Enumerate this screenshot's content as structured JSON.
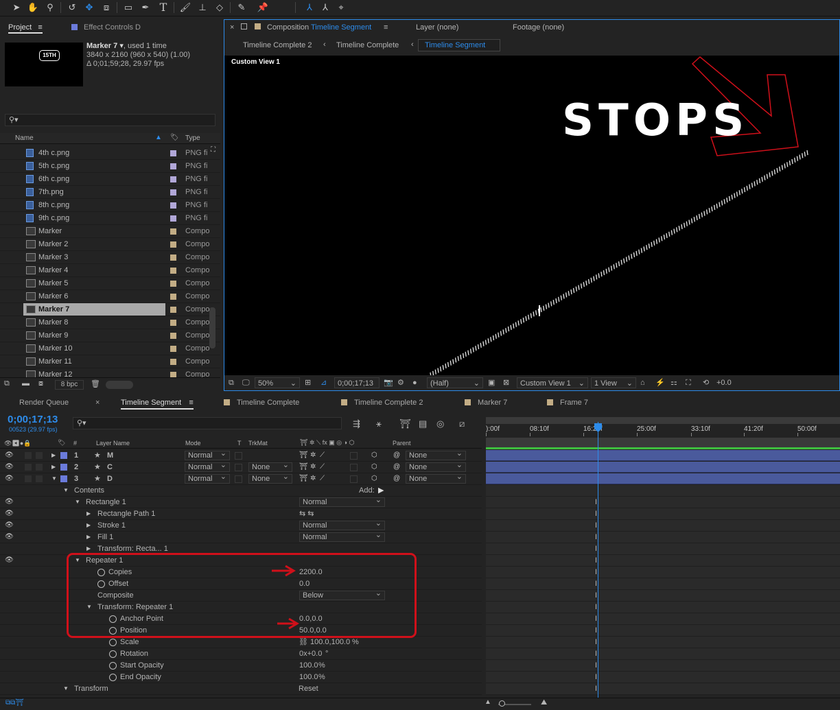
{
  "toolbar": {
    "tools": [
      "selection-tool-icon",
      "hand-tool-icon",
      "zoom-tool-icon",
      "rotate-tool-icon",
      "orbit-camera-icon",
      "pan-behind-icon",
      "rectangle-tool-icon",
      "pen-tool-icon",
      "type-tool-icon",
      "brush-tool-icon",
      "clone-stamp-icon",
      "eraser-icon",
      "roto-brush-icon",
      "puppet-pin-icon",
      "axis-local-icon",
      "axis-world-icon",
      "axis-view-icon"
    ]
  },
  "project": {
    "tab_project": "Project",
    "tab_effect_controls": "Effect Controls D",
    "thumb_text": "15TH",
    "selected_name": "Marker 7",
    "used": ", used 1 time",
    "dims": "3840 x 2160  (960 x 540) (1.00)",
    "duration": "Δ 0;01;59;28, 29.97 fps",
    "col_name": "Name",
    "col_type": "Type",
    "items": [
      {
        "name": "4th c.png",
        "type": "PNG fi",
        "kind": "png",
        "label": "#b1a7d8"
      },
      {
        "name": "5th c.png",
        "type": "PNG fi",
        "kind": "png",
        "label": "#b1a7d8"
      },
      {
        "name": "6th c.png",
        "type": "PNG fi",
        "kind": "png",
        "label": "#b1a7d8"
      },
      {
        "name": "7th.png",
        "type": "PNG fi",
        "kind": "png",
        "label": "#b1a7d8"
      },
      {
        "name": "8th c.png",
        "type": "PNG fi",
        "kind": "png",
        "label": "#b1a7d8"
      },
      {
        "name": "9th c.png",
        "type": "PNG fi",
        "kind": "png",
        "label": "#b1a7d8"
      },
      {
        "name": "Marker",
        "type": "Compo",
        "kind": "comp",
        "label": "#c3ad85"
      },
      {
        "name": "Marker 2",
        "type": "Compo",
        "kind": "comp",
        "label": "#c3ad85"
      },
      {
        "name": "Marker 3",
        "type": "Compo",
        "kind": "comp",
        "label": "#c3ad85"
      },
      {
        "name": "Marker 4",
        "type": "Compo",
        "kind": "comp",
        "label": "#c3ad85"
      },
      {
        "name": "Marker 5",
        "type": "Compo",
        "kind": "comp",
        "label": "#c3ad85"
      },
      {
        "name": "Marker 6",
        "type": "Compo",
        "kind": "comp",
        "label": "#c3ad85"
      },
      {
        "name": "Marker 7",
        "type": "Compo",
        "kind": "comp",
        "label": "#c3ad85",
        "selected": true
      },
      {
        "name": "Marker 8",
        "type": "Compo",
        "kind": "comp",
        "label": "#c3ad85"
      },
      {
        "name": "Marker 9",
        "type": "Compo",
        "kind": "comp",
        "label": "#c3ad85"
      },
      {
        "name": "Marker 10",
        "type": "Compo",
        "kind": "comp",
        "label": "#c3ad85"
      },
      {
        "name": "Marker 11",
        "type": "Compo",
        "kind": "comp",
        "label": "#c3ad85"
      },
      {
        "name": "Marker 12",
        "type": "Compo",
        "kind": "comp",
        "label": "#c3ad85"
      }
    ],
    "bpc": "8 bpc"
  },
  "viewer": {
    "tab_prefix": "Composition",
    "tab_comp_name": "Timeline Segment",
    "tab_layer": "Layer (none)",
    "tab_footage": "Footage (none)",
    "breadcrumbs": [
      "Timeline Complete 2",
      "Timeline Complete",
      "Timeline Segment"
    ],
    "view_label": "Custom View 1",
    "canvas_text": "STOPS",
    "zoom": "50%",
    "timecode": "0;00;17;13",
    "resolution": "(Half)",
    "view_select": "Custom View 1",
    "view_count": "1 View",
    "exposure": "+0.0"
  },
  "timeline": {
    "tabs": [
      {
        "label": "Render Queue",
        "color": ""
      },
      {
        "label": "Timeline Segment",
        "color": ""
      },
      {
        "label": "Timeline Complete",
        "color": "#c3ad85"
      },
      {
        "label": "Timeline Complete 2",
        "color": "#c3ad85"
      },
      {
        "label": "Marker 7",
        "color": "#c3ad85"
      },
      {
        "label": "Frame 7",
        "color": "#c3ad85"
      }
    ],
    "timecode": "0;00;17;13",
    "frames": "00523 (29.97 fps)",
    "col_layer_name": "Layer Name",
    "col_mode": "Mode",
    "col_t": "T",
    "col_trkmat": "TrkMat",
    "col_parent": "Parent",
    "ruler": [
      "):00f",
      "08:10f",
      "16:20f",
      "25:00f",
      "33:10f",
      "41:20f",
      "50:00f"
    ],
    "layers": [
      {
        "num": "1",
        "name": "M",
        "mode": "Normal",
        "trkmat": "",
        "parent": "None"
      },
      {
        "num": "2",
        "name": "C",
        "mode": "Normal",
        "trkmat": "None",
        "parent": "None"
      },
      {
        "num": "3",
        "name": "D",
        "mode": "Normal",
        "trkmat": "None",
        "parent": "None"
      }
    ],
    "props": {
      "contents": "Contents",
      "add": "Add:",
      "rectangle": "Rectangle 1",
      "rectangle_mode": "Normal",
      "rect_path": "Rectangle Path 1",
      "stroke": "Stroke 1",
      "stroke_mode": "Normal",
      "fill": "Fill 1",
      "fill_mode": "Normal",
      "transform_rect": "Transform: Recta... 1",
      "repeater": "Repeater 1",
      "copies": "Copies",
      "copies_val": "2200.0",
      "offset": "Offset",
      "offset_val": "0.0",
      "composite": "Composite",
      "composite_val": "Below",
      "transform_rep": "Transform: Repeater 1",
      "anchor": "Anchor Point",
      "anchor_val": "0.0,0.0",
      "position": "Position",
      "position_val": "50.0,0.0",
      "scale": "Scale",
      "scale_val": "100.0,100.0",
      "scale_unit": "%",
      "rotation": "Rotation",
      "rotation_val": "0x+0.0",
      "rotation_unit": "°",
      "start_opacity": "Start Opacity",
      "start_opacity_val": "100.0",
      "end_opacity": "End Opacity",
      "end_opacity_val": "100.0",
      "pct": "%",
      "transform": "Transform",
      "reset": "Reset"
    }
  },
  "colors": {
    "accent": "#2d8ceb",
    "annotation_red": "#d0101a",
    "layer_label": "#6b7bdb",
    "track_bar": "#4a5a9c",
    "work_area": "#3fbf3f"
  }
}
